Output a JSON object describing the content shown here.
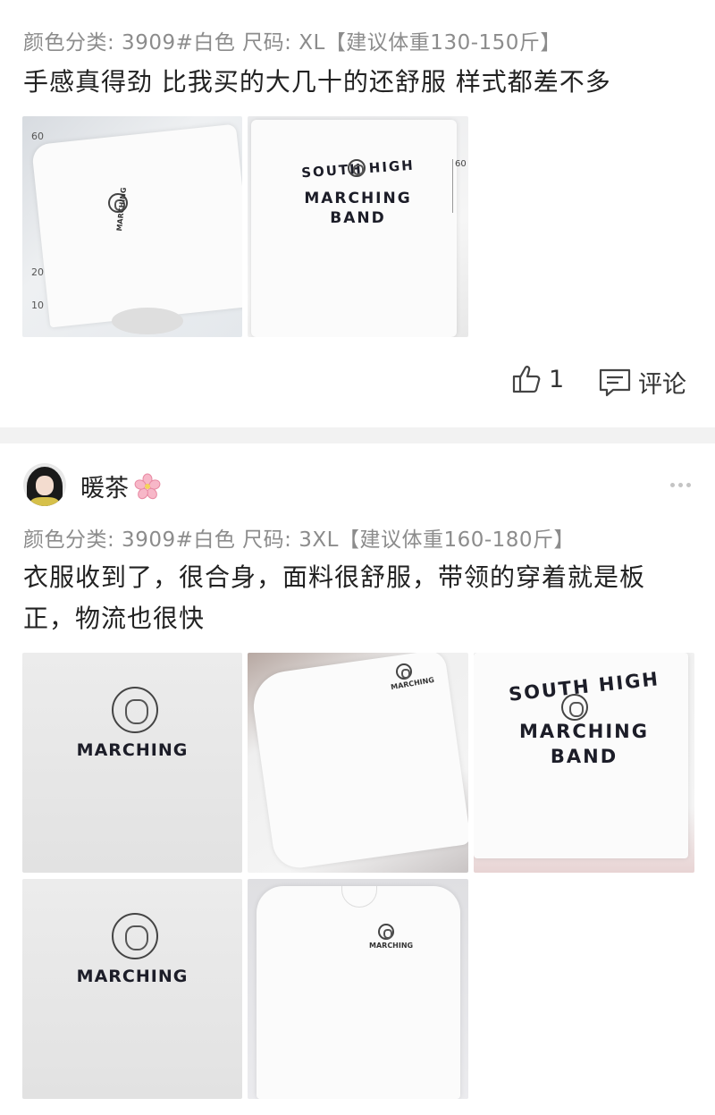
{
  "review1": {
    "meta": "颜色分类: 3909#白色  尺码: XL【建议体重130-150斤】",
    "text": "手感真得劲  比我买的大几十的还舒服  样式都差不多",
    "photo1": {
      "ruler_marks": [
        "60",
        "20",
        "10"
      ],
      "chest_print": "MARCHING"
    },
    "photo2": {
      "line1": "SOUTH HIGH",
      "line2": "MARCHING",
      "line3": "BAND",
      "ruler_mark": "60"
    },
    "likes": "1",
    "comment_label": "评论"
  },
  "review2": {
    "username": "暖茶",
    "meta": "颜色分类: 3909#白色  尺码: 3XL【建议体重160-180斤】",
    "text_line1": "衣服收到了，很合身，面料很舒服，带领的穿着就是板",
    "text_line2": "正，物流也很快",
    "photos": {
      "p1": {
        "chest_print": "MARCHING"
      },
      "p2": {
        "chest_print": "MARCHING"
      },
      "p3": {
        "line1": "SOUTH HIGH",
        "line2": "MARCHING",
        "line3": "BAND"
      },
      "p4": {
        "chest_print": "MARCHING"
      },
      "p5": {
        "chest_print": "MARCHING"
      }
    }
  },
  "colors": {
    "meta_gray": "#8c8c8c",
    "divider": "#f2f2f2",
    "print_navy": "#1c1d28"
  },
  "icons": [
    "thumbs-up-icon",
    "comment-icon",
    "more-icon",
    "cherry-blossom-icon"
  ]
}
